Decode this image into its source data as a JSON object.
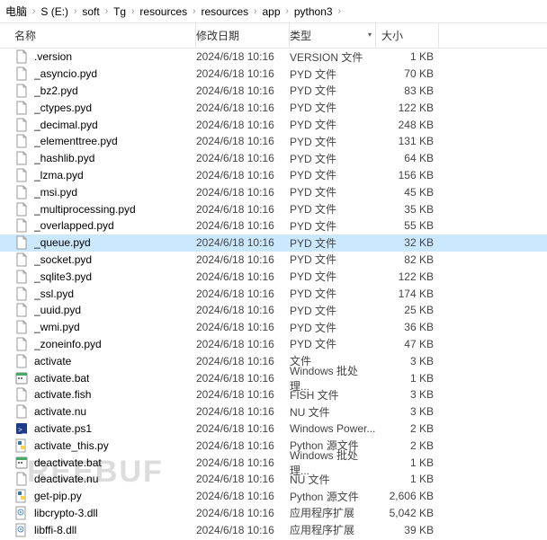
{
  "breadcrumb": [
    "电脑",
    "S (E:)",
    "soft",
    "Tg",
    "resources",
    "resources",
    "app",
    "python3"
  ],
  "columns": {
    "name": "名称",
    "date": "修改日期",
    "type": "类型",
    "size": "大小"
  },
  "watermark": "REEBUF",
  "selected_index": 11,
  "files": [
    {
      "icon": "file-blank",
      "name": ".version",
      "date": "2024/6/18 10:16",
      "type": "VERSION 文件",
      "size": "1 KB"
    },
    {
      "icon": "file-blank",
      "name": "_asyncio.pyd",
      "date": "2024/6/18 10:16",
      "type": "PYD 文件",
      "size": "70 KB"
    },
    {
      "icon": "file-blank",
      "name": "_bz2.pyd",
      "date": "2024/6/18 10:16",
      "type": "PYD 文件",
      "size": "83 KB"
    },
    {
      "icon": "file-blank",
      "name": "_ctypes.pyd",
      "date": "2024/6/18 10:16",
      "type": "PYD 文件",
      "size": "122 KB"
    },
    {
      "icon": "file-blank",
      "name": "_decimal.pyd",
      "date": "2024/6/18 10:16",
      "type": "PYD 文件",
      "size": "248 KB"
    },
    {
      "icon": "file-blank",
      "name": "_elementtree.pyd",
      "date": "2024/6/18 10:16",
      "type": "PYD 文件",
      "size": "131 KB"
    },
    {
      "icon": "file-blank",
      "name": "_hashlib.pyd",
      "date": "2024/6/18 10:16",
      "type": "PYD 文件",
      "size": "64 KB"
    },
    {
      "icon": "file-blank",
      "name": "_lzma.pyd",
      "date": "2024/6/18 10:16",
      "type": "PYD 文件",
      "size": "156 KB"
    },
    {
      "icon": "file-blank",
      "name": "_msi.pyd",
      "date": "2024/6/18 10:16",
      "type": "PYD 文件",
      "size": "45 KB"
    },
    {
      "icon": "file-blank",
      "name": "_multiprocessing.pyd",
      "date": "2024/6/18 10:16",
      "type": "PYD 文件",
      "size": "35 KB"
    },
    {
      "icon": "file-blank",
      "name": "_overlapped.pyd",
      "date": "2024/6/18 10:16",
      "type": "PYD 文件",
      "size": "55 KB"
    },
    {
      "icon": "file-blank",
      "name": "_queue.pyd",
      "date": "2024/6/18 10:16",
      "type": "PYD 文件",
      "size": "32 KB"
    },
    {
      "icon": "file-blank",
      "name": "_socket.pyd",
      "date": "2024/6/18 10:16",
      "type": "PYD 文件",
      "size": "82 KB"
    },
    {
      "icon": "file-blank",
      "name": "_sqlite3.pyd",
      "date": "2024/6/18 10:16",
      "type": "PYD 文件",
      "size": "122 KB"
    },
    {
      "icon": "file-blank",
      "name": "_ssl.pyd",
      "date": "2024/6/18 10:16",
      "type": "PYD 文件",
      "size": "174 KB"
    },
    {
      "icon": "file-blank",
      "name": "_uuid.pyd",
      "date": "2024/6/18 10:16",
      "type": "PYD 文件",
      "size": "25 KB"
    },
    {
      "icon": "file-blank",
      "name": "_wmi.pyd",
      "date": "2024/6/18 10:16",
      "type": "PYD 文件",
      "size": "36 KB"
    },
    {
      "icon": "file-blank",
      "name": "_zoneinfo.pyd",
      "date": "2024/6/18 10:16",
      "type": "PYD 文件",
      "size": "47 KB"
    },
    {
      "icon": "file-blank",
      "name": "activate",
      "date": "2024/6/18 10:16",
      "type": "文件",
      "size": "3 KB"
    },
    {
      "icon": "file-bat",
      "name": "activate.bat",
      "date": "2024/6/18 10:16",
      "type": "Windows 批处理...",
      "size": "1 KB"
    },
    {
      "icon": "file-blank",
      "name": "activate.fish",
      "date": "2024/6/18 10:16",
      "type": "FISH 文件",
      "size": "3 KB"
    },
    {
      "icon": "file-blank",
      "name": "activate.nu",
      "date": "2024/6/18 10:16",
      "type": "NU 文件",
      "size": "3 KB"
    },
    {
      "icon": "file-ps1",
      "name": "activate.ps1",
      "date": "2024/6/18 10:16",
      "type": "Windows Power...",
      "size": "2 KB"
    },
    {
      "icon": "file-py",
      "name": "activate_this.py",
      "date": "2024/6/18 10:16",
      "type": "Python 源文件",
      "size": "2 KB"
    },
    {
      "icon": "file-bat",
      "name": "deactivate.bat",
      "date": "2024/6/18 10:16",
      "type": "Windows 批处理...",
      "size": "1 KB"
    },
    {
      "icon": "file-blank",
      "name": "deactivate.nu",
      "date": "2024/6/18 10:16",
      "type": "NU 文件",
      "size": "1 KB"
    },
    {
      "icon": "file-py",
      "name": "get-pip.py",
      "date": "2024/6/18 10:16",
      "type": "Python 源文件",
      "size": "2,606 KB"
    },
    {
      "icon": "file-dll",
      "name": "libcrypto-3.dll",
      "date": "2024/6/18 10:16",
      "type": "应用程序扩展",
      "size": "5,042 KB"
    },
    {
      "icon": "file-dll",
      "name": "libffi-8.dll",
      "date": "2024/6/18 10:16",
      "type": "应用程序扩展",
      "size": "39 KB"
    }
  ]
}
